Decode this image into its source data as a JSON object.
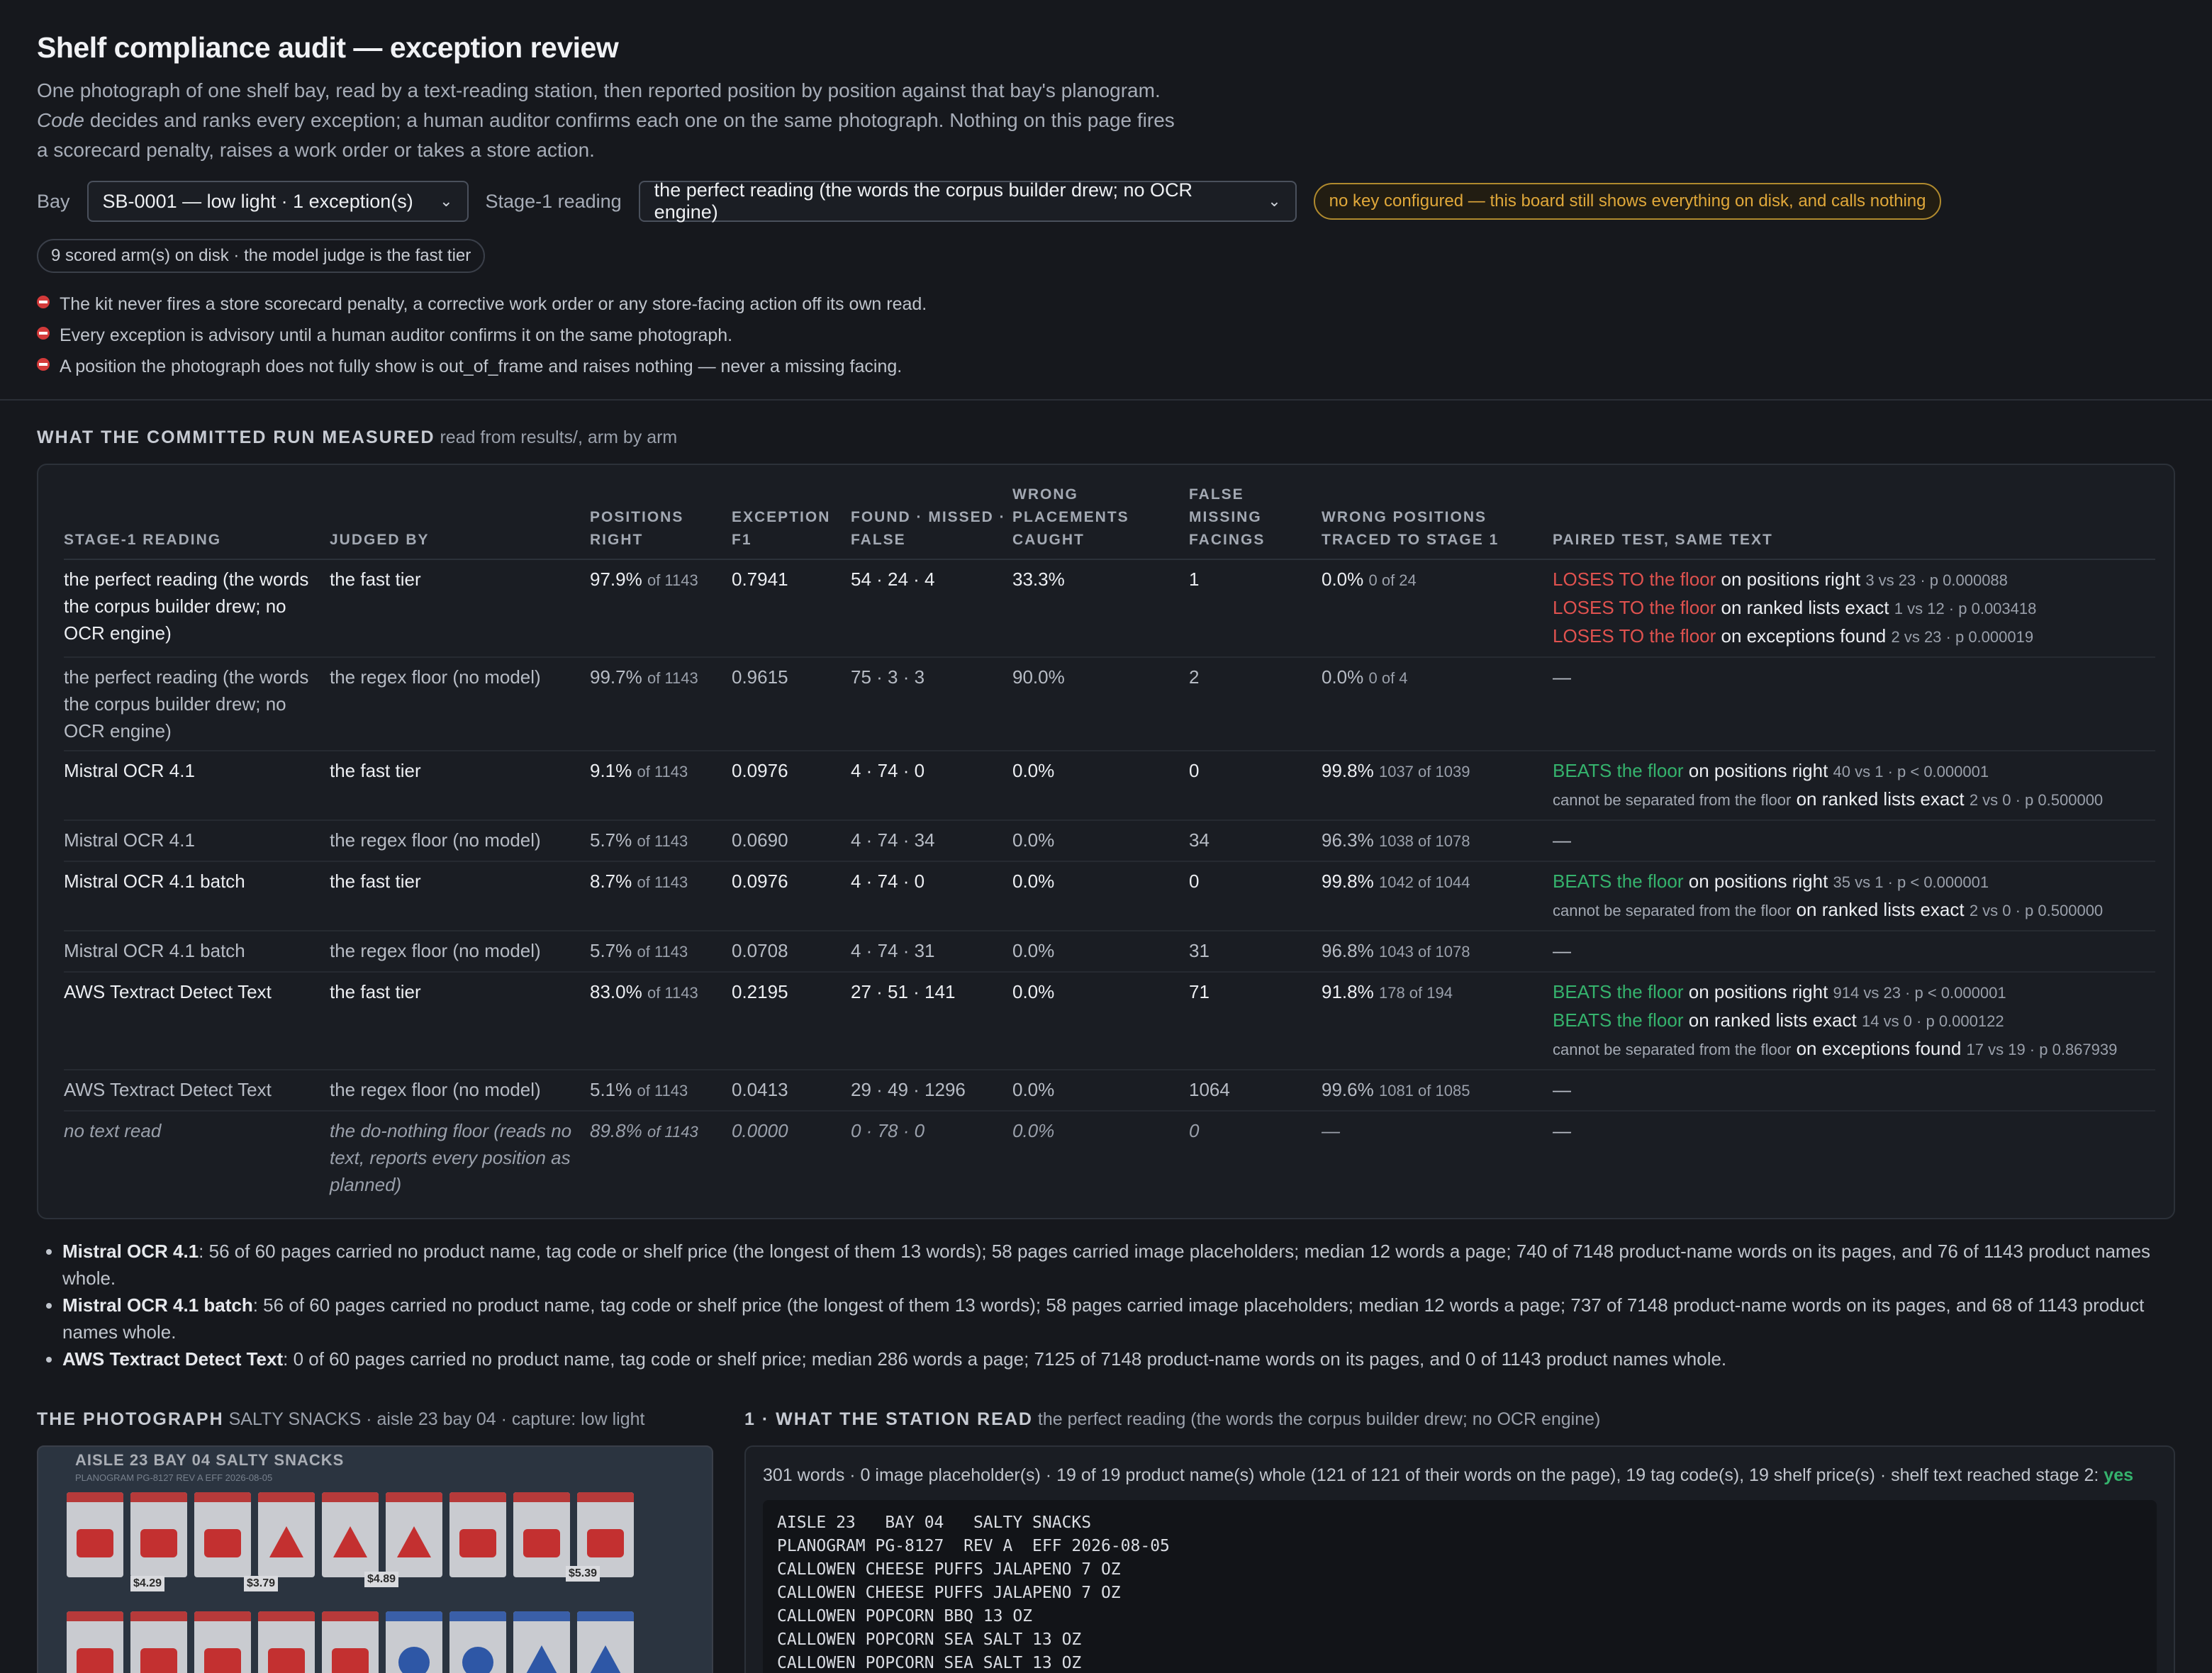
{
  "header": {
    "title": "Shelf compliance audit — exception review",
    "intro_part1": "One photograph of one shelf bay, read by a text-reading station, then reported position by position against that bay's planogram. ",
    "intro_code": "Code",
    "intro_part2": " decides and ranks every exception; a human auditor confirms each one on the same photograph. Nothing on this page fires a scorecard penalty, raises a work order or takes a store action."
  },
  "controls": {
    "bay_label": "Bay",
    "bay_value": "SB-0001 — low light · 1 exception(s)",
    "stage1_label": "Stage-1 reading",
    "stage1_value": "the perfect reading (the words the corpus builder drew; no OCR engine)",
    "key_warning": "no key configured — this board still shows everything on disk, and calls nothing",
    "arms_pill": "9 scored arm(s) on disk · the model judge is the fast tier"
  },
  "rules": [
    "The kit never fires a store scorecard penalty, a corrective work order or any store-facing action off its own read.",
    "Every exception is advisory until a human auditor confirms it on the same photograph.",
    "A position the photograph does not fully show is out_of_frame and raises nothing — never a missing facing."
  ],
  "measured": {
    "caption": "What the committed run measured",
    "sub": "read from results/, arm by arm",
    "columns": [
      "Stage-1 reading",
      "Judged by",
      "Positions right",
      "Exception F1",
      "Found · missed · false",
      "Wrong placements caught",
      "False missing facings",
      "Wrong positions traced to stage 1",
      "Paired test, same text"
    ],
    "rows": [
      {
        "reading": "the perfect reading (the words the corpus builder drew; no OCR engine)",
        "judge": "the fast tier",
        "pos": "97.9%",
        "pos_of": "of 1143",
        "f1": "0.7941",
        "fmf": "54 · 24 · 4",
        "wrong_caught": "33.3%",
        "false_missing": "1",
        "traced": "0.0%",
        "traced_of": "0 of 24",
        "paired": [
          {
            "verdict": "LOSES TO the floor",
            "metric": "on positions right",
            "stat": "3 vs 23 · p 0.000088"
          },
          {
            "verdict": "LOSES TO the floor",
            "metric": "on ranked lists exact",
            "stat": "1 vs 12 · p 0.003418"
          },
          {
            "verdict": "LOSES TO the floor",
            "metric": "on exceptions found",
            "stat": "2 vs 23 · p 0.000019"
          }
        ]
      },
      {
        "reading": "the perfect reading (the words the corpus builder drew; no OCR engine)",
        "judge": "the regex floor (no model)",
        "pos": "99.7%",
        "pos_of": "of 1143",
        "f1": "0.9615",
        "fmf": "75 · 3 · 3",
        "wrong_caught": "90.0%",
        "false_missing": "2",
        "traced": "0.0%",
        "traced_of": "0 of 4",
        "paired_dash": "—"
      },
      {
        "reading": "Mistral OCR 4.1",
        "judge": "the fast tier",
        "pos": "9.1%",
        "pos_of": "of 1143",
        "f1": "0.0976",
        "fmf": "4 · 74 · 0",
        "wrong_caught": "0.0%",
        "false_missing": "0",
        "traced": "99.8%",
        "traced_of": "1037 of 1039",
        "paired": [
          {
            "verdict": "BEATS the floor",
            "metric": "on positions right",
            "stat": "40 vs 1 · p < 0.000001"
          },
          {
            "verdict": "cannot be separated from the floor",
            "metric": "on ranked lists exact",
            "stat": "2 vs 0 · p 0.500000"
          }
        ]
      },
      {
        "reading": "Mistral OCR 4.1",
        "judge": "the regex floor (no model)",
        "pos": "5.7%",
        "pos_of": "of 1143",
        "f1": "0.0690",
        "fmf": "4 · 74 · 34",
        "wrong_caught": "0.0%",
        "false_missing": "34",
        "traced": "96.3%",
        "traced_of": "1038 of 1078",
        "paired_dash": "—"
      },
      {
        "reading": "Mistral OCR 4.1 batch",
        "judge": "the fast tier",
        "pos": "8.7%",
        "pos_of": "of 1143",
        "f1": "0.0976",
        "fmf": "4 · 74 · 0",
        "wrong_caught": "0.0%",
        "false_missing": "0",
        "traced": "99.8%",
        "traced_of": "1042 of 1044",
        "paired": [
          {
            "verdict": "BEATS the floor",
            "metric": "on positions right",
            "stat": "35 vs 1 · p < 0.000001"
          },
          {
            "verdict": "cannot be separated from the floor",
            "metric": "on ranked lists exact",
            "stat": "2 vs 0 · p 0.500000"
          }
        ]
      },
      {
        "reading": "Mistral OCR 4.1 batch",
        "judge": "the regex floor (no model)",
        "pos": "5.7%",
        "pos_of": "of 1143",
        "f1": "0.0708",
        "fmf": "4 · 74 · 31",
        "wrong_caught": "0.0%",
        "false_missing": "31",
        "traced": "96.8%",
        "traced_of": "1043 of 1078",
        "paired_dash": "—"
      },
      {
        "reading": "AWS Textract Detect Text",
        "judge": "the fast tier",
        "pos": "83.0%",
        "pos_of": "of 1143",
        "f1": "0.2195",
        "fmf": "27 · 51 · 141",
        "wrong_caught": "0.0%",
        "false_missing": "71",
        "traced": "91.8%",
        "traced_of": "178 of 194",
        "paired": [
          {
            "verdict": "BEATS the floor",
            "metric": "on positions right",
            "stat": "914 vs 23 · p < 0.000001"
          },
          {
            "verdict": "BEATS the floor",
            "metric": "on ranked lists exact",
            "stat": "14 vs 0 · p 0.000122"
          },
          {
            "verdict": "cannot be separated from the floor",
            "metric": "on exceptions found",
            "stat": "17 vs 19 · p 0.867939"
          }
        ]
      },
      {
        "reading": "AWS Textract Detect Text",
        "judge": "the regex floor (no model)",
        "pos": "5.1%",
        "pos_of": "of 1143",
        "f1": "0.0413",
        "fmf": "29 · 49 · 1296",
        "wrong_caught": "0.0%",
        "false_missing": "1064",
        "traced": "99.6%",
        "traced_of": "1081 of 1085",
        "paired_dash": "—"
      },
      {
        "reading": "no text read",
        "judge": "the do-nothing floor (reads no text, reports every position as planned)",
        "pos": "89.8%",
        "pos_of": "of 1143",
        "f1": "0.0000",
        "fmf": "0 · 78 · 0",
        "wrong_caught": "0.0%",
        "false_missing": "0",
        "traced": "—",
        "traced_of": "",
        "paired_dash": "—"
      }
    ]
  },
  "notes": [
    {
      "name": "Mistral OCR 4.1",
      "text": ": 56 of 60 pages carried no product name, tag code or shelf price (the longest of them 13 words); 58 pages carried image placeholders; median 12 words a page; 740 of 7148 product-name words on its pages, and 76 of 1143 product names whole."
    },
    {
      "name": "Mistral OCR 4.1 batch",
      "text": ": 56 of 60 pages carried no product name, tag code or shelf price (the longest of them 13 words); 58 pages carried image placeholders; median 12 words a page; 737 of 7148 product-name words on its pages, and 68 of 1143 product names whole."
    },
    {
      "name": "AWS Textract Detect Text",
      "text": ": 0 of 60 pages carried no product name, tag code or shelf price; median 286 words a page; 7125 of 7148 product-name words on its pages, and 0 of 1143 product names whole."
    }
  ],
  "photo": {
    "caption": "The photograph",
    "sub": "SALTY SNACKS · aisle 23 bay 04 · capture: low light",
    "header_text": "AISLE 23   BAY 04   SALTY SNACKS",
    "sub_text": "PLANOGRAM PG-8127  REV A  EFF 2026-08-05",
    "prices": [
      "$4.29",
      "$3.79",
      "$4.89",
      "$5.39"
    ]
  },
  "station": {
    "caption": "1 · What the station read",
    "sub": "the perfect reading (the words the corpus builder drew; no OCR engine)",
    "stats": "301 words · 0 image placeholder(s) · 19 of 19 product name(s) whole (121 of 121 of their words on the page), 19 tag code(s), 19 shelf price(s) · shelf text reached stage 2: ",
    "stats_yes": "yes",
    "ocr_text": "AISLE 23   BAY 04   SALTY SNACKS\nPLANOGRAM PG-8127  REV A  EFF 2026-08-05\nCALLOWEN CHEESE PUFFS JALAPENO 7 OZ\nCALLOWEN CHEESE PUFFS JALAPENO 7 OZ\nCALLOWEN POPCORN BBQ 13 OZ\nCALLOWEN POPCORN SEA SALT 13 OZ\nCALLOWEN POPCORN SEA SALT 13 OZ"
  },
  "colors": {
    "loses": "#e0524f",
    "beats": "#35b36d",
    "warn": "#e0a83a",
    "bg": "#16181d"
  }
}
